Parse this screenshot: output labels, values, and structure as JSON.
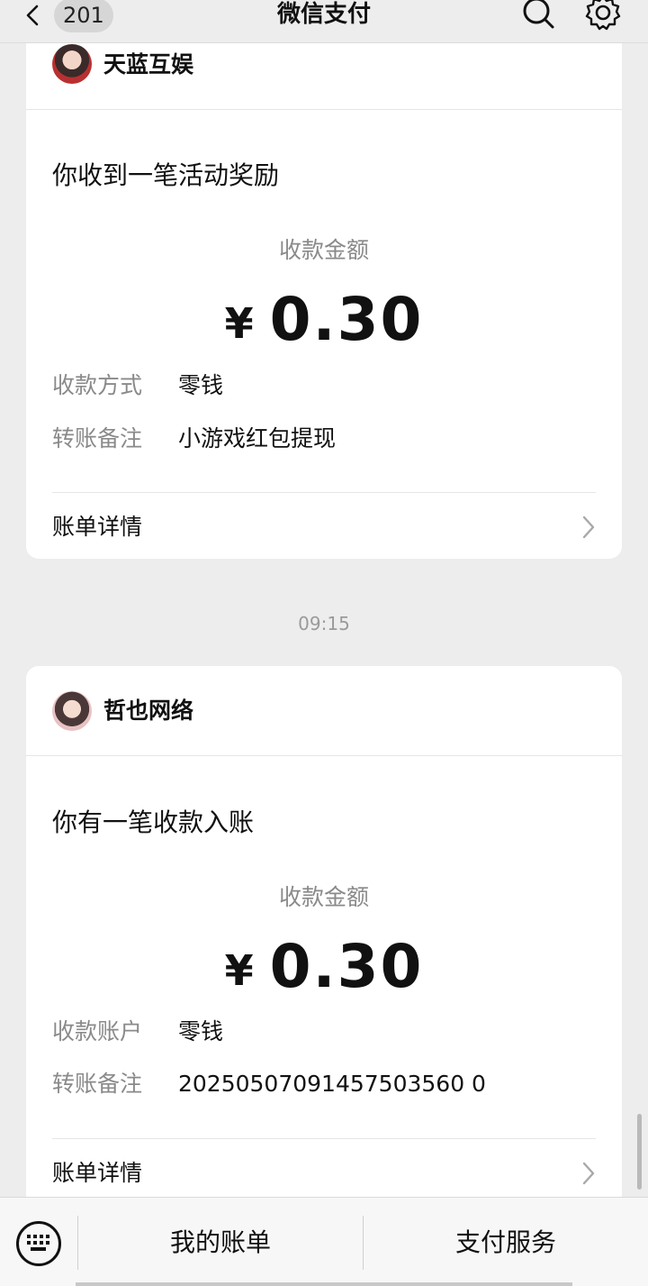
{
  "header": {
    "badge": "201",
    "title": "微信支付"
  },
  "cards": [
    {
      "merchant": "天蓝互娱",
      "headline": "你收到一笔活动奖励",
      "amount_label": "收款金额",
      "currency": "¥",
      "amount": "0.30",
      "rows": [
        {
          "key": "收款方式",
          "value": "零钱"
        },
        {
          "key": "转账备注",
          "value": "小游戏红包提现"
        }
      ],
      "detail_label": "账单详情"
    },
    {
      "merchant": "哲也网络",
      "headline": "你有一笔收款入账",
      "amount_label": "收款金额",
      "currency": "¥",
      "amount": "0.30",
      "rows": [
        {
          "key": "收款账户",
          "value": "零钱"
        },
        {
          "key": "转账备注",
          "value": "20250507091457503560 0"
        }
      ],
      "detail_label": "账单详情"
    }
  ],
  "timestamp": "09:15",
  "bottom": {
    "menu_1": "我的账单",
    "menu_2": "支付服务"
  }
}
